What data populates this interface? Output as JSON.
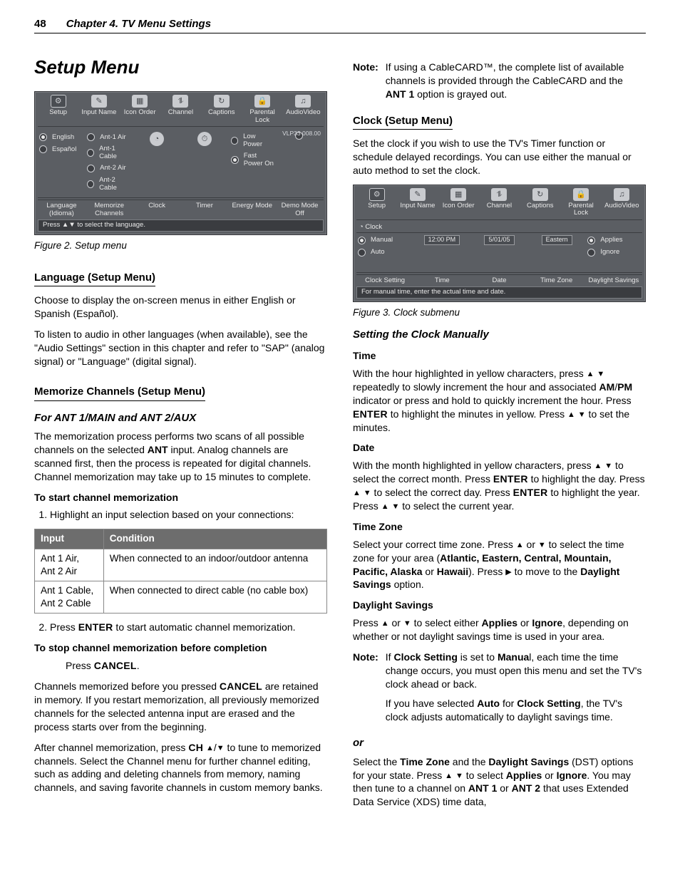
{
  "header": {
    "page": "48",
    "chapter": "Chapter 4. TV Menu Settings"
  },
  "title": "Setup Menu",
  "fig2": {
    "caption": "Figure 2. Setup menu",
    "tabs": [
      "Setup",
      "Input Name",
      "Icon Order",
      "Channel",
      "Captions",
      "Parental Lock",
      "AudioVideo"
    ],
    "corner": "VLP33 008.00",
    "langs": [
      "English",
      "Español"
    ],
    "mem": [
      "Ant-1 Air",
      "Ant-1 Cable",
      "Ant-2 Air",
      "Ant-2 Cable"
    ],
    "energy": [
      "Low Power",
      "Fast Power On"
    ],
    "row2": [
      "Language (Idioma)",
      "Memorize Channels",
      "Clock",
      "Timer",
      "Energy Mode",
      "Demo Mode Off"
    ],
    "hint": "Press ▲▼ to select the language."
  },
  "lang": {
    "h": "Language (Setup Menu)",
    "p1": "Choose to display the on-screen menus in either English or Spanish (Español).",
    "p2": "To listen to audio in other languages (when available), see the \"Audio Settings\" section in this chapter and refer to \"SAP\" (analog signal) or \"Language\" (digital signal)."
  },
  "mem": {
    "h": "Memorize Channels (Setup Menu)",
    "sub": "For ANT 1/MAIN and ANT 2/AUX",
    "p1_a": "The memorization process performs two scans of all possible channels on the selected ",
    "p1_ant": "ANT",
    "p1_b": " input.  Analog channels are scanned first, then the process is repeated for digital channels.  Channel memorization may take up to 15 minutes to complete.",
    "start_h": "To start channel memorization",
    "step1": "Highlight an input selection based on your connections:",
    "tbl": {
      "h1": "Input",
      "h2": "Condition",
      "r1a": "Ant 1 Air,\nAnt 2 Air",
      "r1b": "When connected to an indoor/outdoor antenna",
      "r2a": "Ant 1 Cable,\nAnt 2 Cable",
      "r2b": "When connected to direct cable (no cable box)"
    },
    "step2_a": "Press ",
    "step2_k": "ENTER",
    "step2_b": " to start automatic channel memorization.",
    "stop_h": "To stop channel memorization before completion",
    "stop_a": "Press ",
    "stop_k": "CANCEL",
    "stop_b": ".",
    "p2_a": "Channels memorized before you pressed ",
    "p2_k": "CANCEL",
    "p2_b": " are retained in memory.  If you restart memorization, all previously memorized channels for the selected antenna input are erased and the process starts over from the beginning.",
    "p3_a": "After channel memorization, press ",
    "p3_k": "CH",
    "p3_b": " to tune to memorized channels.  Select the Channel menu for further channel editing, such as adding and deleting channels from memory, naming channels, and saving favorite channels in custom memory banks."
  },
  "noteR": {
    "label": "Note:",
    "a": "If using a CableCARD™, the complete list of available channels is provided through the CableCARD and the ",
    "b": "ANT 1",
    "c": " option is grayed out."
  },
  "clock": {
    "h": "Clock (Setup Menu)",
    "p": "Set the clock if you wish to use the TV's Timer function or schedule delayed recordings.  You can use either the manual or auto method to set the clock."
  },
  "fig3": {
    "caption": "Figure 3. Clock submenu",
    "tabs": [
      "Setup",
      "Input Name",
      "Icon Order",
      "Channel",
      "Captions",
      "Parental Lock",
      "AudioVideo"
    ],
    "clockLabel": "Clock",
    "setting": [
      "Manual",
      "Auto"
    ],
    "time": "12:00 PM",
    "date": "5/01/05",
    "zone": "Eastern",
    "ds": [
      "Applies",
      "Ignore"
    ],
    "row2": [
      "Clock Setting",
      "Time",
      "Date",
      "Time Zone",
      "Daylight Savings"
    ],
    "hint": "For manual time, enter the actual time and date."
  },
  "scm": {
    "h": "Setting the Clock Manually",
    "time_h": "Time",
    "time_a": "With the hour highlighted in yellow characters, press ",
    "time_b": " repeatedly to slowly increment the hour and associated ",
    "time_am": "AM",
    "time_slash": "/",
    "time_pm": "PM",
    "time_c": " indicator or press and hold to quickly increment the hour.  Press ",
    "time_k": "ENTER",
    "time_d": " to highlight the minutes in yellow. Press ",
    "time_e": " to set the minutes.",
    "date_h": "Date",
    "date_a": "With the month highlighted in yellow characters, press ",
    "date_b": " to select the correct month.  Press ",
    "date_k1": "ENTER",
    "date_c": " to highlight the day.  Press ",
    "date_d": " to select the correct day.  Press ",
    "date_k2": "ENTER",
    "date_e": " to highlight the year.  Press ",
    "date_f": " to select the current year.",
    "tz_h": "Time Zone",
    "tz_a": "Select your correct time zone.  Press ",
    "tz_b": " to select the time zone for your area (",
    "tz_list": "Atlantic, Eastern, Central, Mountain, Pacific, Alaska",
    "tz_or": " or ",
    "tz_hi": "Hawaii",
    "tz_c": ").  Press ",
    "tz_d": " to move to the ",
    "tz_ds": "Daylight Savings",
    "tz_e": " option.",
    "ds_h": "Daylight Savings",
    "ds_a": "Press ",
    "ds_b": " to select either ",
    "ds_ap": "Applies",
    "ds_or": " or ",
    "ds_ig": "Ignore",
    "ds_c": ", depending on whether or not daylight savings time is used in your area."
  },
  "note2": {
    "label": "Note:",
    "a": "If ",
    "b": "Clock Setting",
    "c": " is set to ",
    "d": "Manua",
    "e": "l, each time the time change occurs, you must open this menu and set the TV's clock ahead or back.",
    "f": "If you have selected ",
    "g": "Auto",
    "h": " for ",
    "i": "Clock Setting",
    "j": ", the TV's clock adjusts automatically to daylight savings time."
  },
  "sca": {
    "h": " or ",
    "a": "Select the ",
    "b": "Time Zone",
    "c": " and the ",
    "d": "Daylight Savings",
    "e": " (DST) options for your state.  Press ",
    "f": " to select ",
    "g": "Applies",
    "i": "Ignore",
    "j": ".  You may then tune to a channel on ",
    "k": "ANT 1",
    "l": " or ",
    "m": "ANT 2",
    "n": " that uses Extended Data Service (XDS) time data,"
  }
}
